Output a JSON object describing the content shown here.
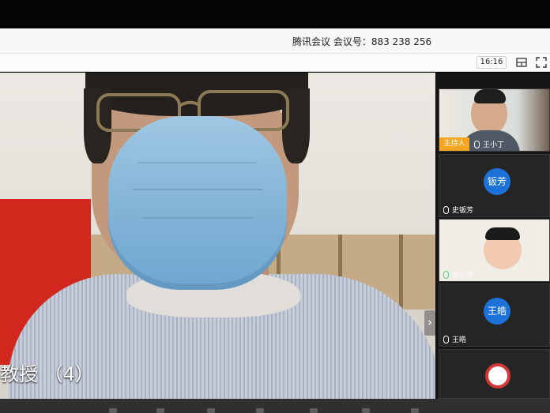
{
  "header": {
    "meeting_title": "腾讯会议 会议号：883 238 256",
    "time": "16:16"
  },
  "main_video": {
    "speaker_caption": "教授 （4）"
  },
  "participants": [
    {
      "name": "王小丁",
      "badge": "主持人",
      "type": "video"
    },
    {
      "name": "史钣芳",
      "avatar_text": "钣芳",
      "type": "avatar"
    },
    {
      "name": "胡士平",
      "type": "video"
    },
    {
      "name": "王皓",
      "avatar_text": "王皓",
      "type": "avatar"
    },
    {
      "name": "",
      "type": "video"
    }
  ],
  "icons": {
    "layout": "layout-icon",
    "fullscreen": "fullscreen-icon",
    "next": "chevron-right-icon",
    "mic": "microphone-icon"
  },
  "colors": {
    "host_badge": "#f5a623",
    "avatar_blue": "#1c72d8",
    "mask_blue": "#8ab8da",
    "red_panel": "#d1271c"
  }
}
